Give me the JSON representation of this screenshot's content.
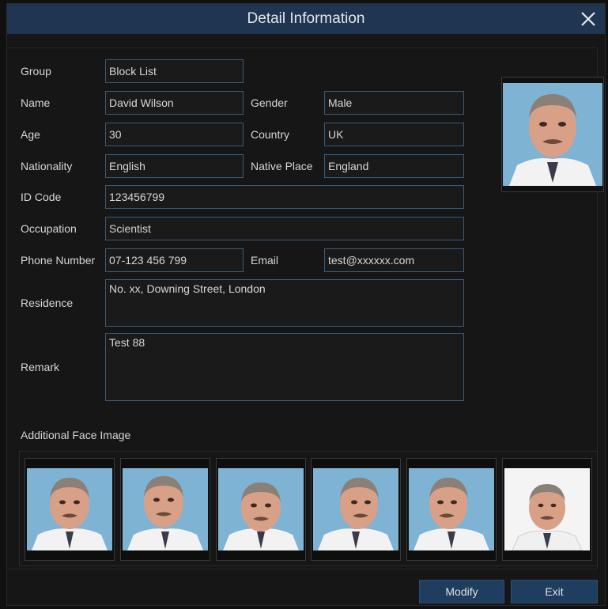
{
  "dialog": {
    "title": "Detail Information"
  },
  "form": {
    "group_label": "Group",
    "group_value": "Block List",
    "name_label": "Name",
    "name_value": "David Wilson",
    "gender_label": "Gender",
    "gender_value": "Male",
    "age_label": "Age",
    "age_value": "30",
    "country_label": "Country",
    "country_value": "UK",
    "nationality_label": "Nationality",
    "nationality_value": "English",
    "native_place_label": "Native Place",
    "native_place_value": "England",
    "id_code_label": "ID Code",
    "id_code_value": "123456799",
    "occupation_label": "Occupation",
    "occupation_value": "Scientist",
    "phone_label": "Phone Number",
    "phone_value": "07-123 456 799",
    "email_label": "Email",
    "email_value": "test@xxxxxx.com",
    "residence_label": "Residence",
    "residence_value": "No. xx, Downing Street, London",
    "remark_label": "Remark",
    "remark_value": "Test 88"
  },
  "additional": {
    "label": "Additional Face Image"
  },
  "buttons": {
    "modify": "Modify",
    "exit": "Exit"
  },
  "colors": {
    "titlebar": "#1f3552",
    "field_border": "#3a5a7a",
    "button": "#1f3d5e"
  }
}
